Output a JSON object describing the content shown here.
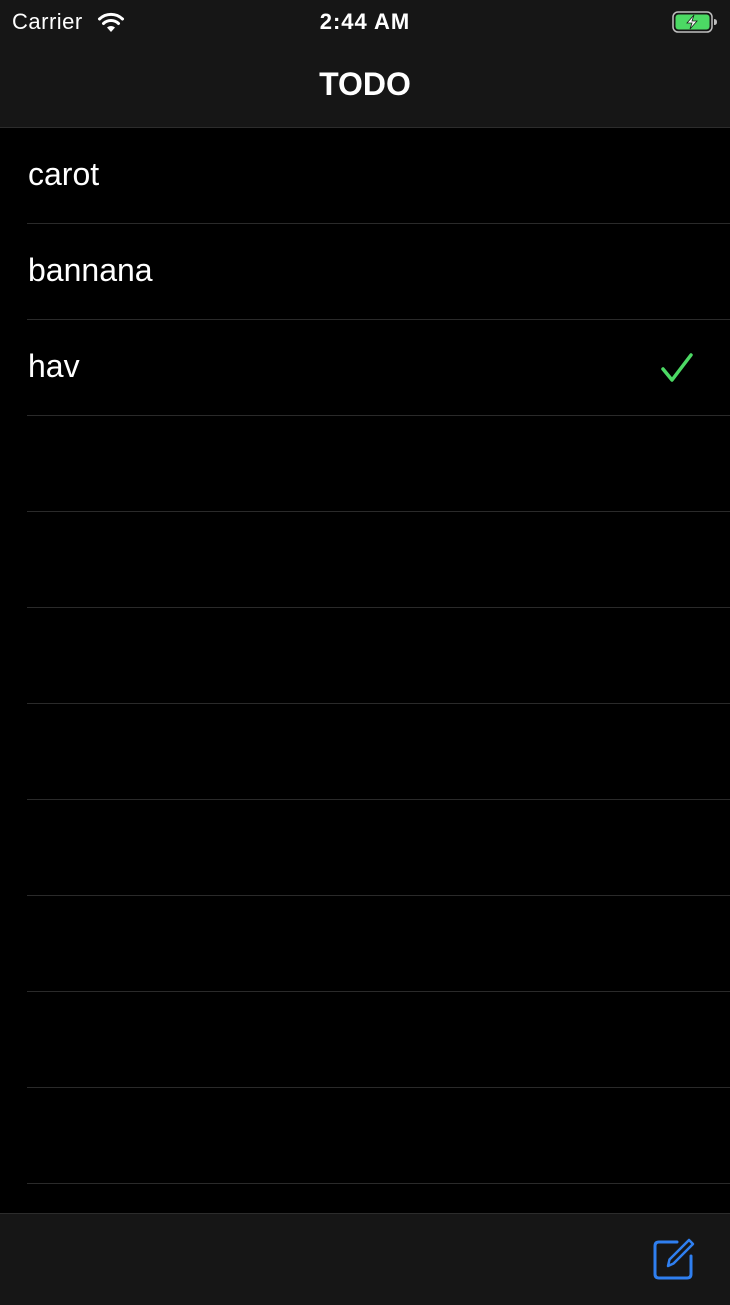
{
  "status_bar": {
    "carrier": "Carrier",
    "time": "2:44 AM",
    "wifi_icon": "wifi-icon",
    "battery_icon": "battery-charging-icon",
    "battery_color": "#4cd964"
  },
  "nav": {
    "title": "TODO"
  },
  "todo_items": [
    {
      "label": "carot",
      "done": false
    },
    {
      "label": "bannana",
      "done": false
    },
    {
      "label": "hav",
      "done": true
    }
  ],
  "toolbar": {
    "compose_icon": "compose-icon",
    "accent": "#2f7ff0"
  },
  "colors": {
    "background": "#000000",
    "bar": "#161616",
    "separator": "#2a2a2a",
    "check": "#4cd964"
  }
}
